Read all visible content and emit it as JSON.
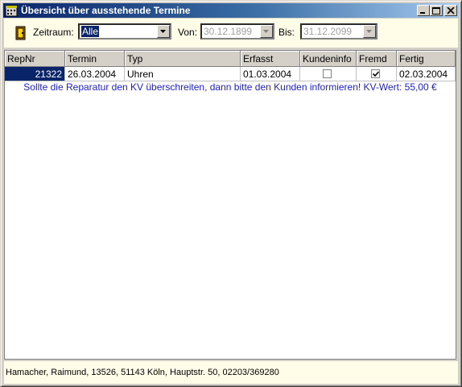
{
  "window": {
    "title": "Übersicht über ausstehende Termine",
    "colors": {
      "titlebar_start": "#0a246a",
      "titlebar_end": "#a6caf0",
      "panel_bg": "#fffde8",
      "note_text": "#2020d0",
      "selection": "#0a246a"
    }
  },
  "filter": {
    "zeitraum_label": "Zeitraum:",
    "zeitraum_value": "Alle",
    "von_label": "Von:",
    "von_value": "30.12.1899",
    "bis_label": "Bis:",
    "bis_value": "31.12.2099"
  },
  "table": {
    "columns": [
      "RepNr",
      "Termin",
      "Typ",
      "Erfasst",
      "Kundeninfo",
      "Fremd",
      "Fertig"
    ],
    "rows": [
      {
        "repnr": "21322",
        "termin": "26.03.2004",
        "typ": "Uhren",
        "erfasst": "01.03.2004",
        "kundeninfo": false,
        "fremd": true,
        "fertig": "02.03.2004",
        "note": "Sollte die Reparatur den KV überschreiten, dann bitte den Kunden informieren! KV-Wert: 55,00 €"
      }
    ]
  },
  "status": {
    "text": "Hamacher, Raimund, 13526, 51143 Köln, Hauptstr. 50, 02203/369280"
  }
}
